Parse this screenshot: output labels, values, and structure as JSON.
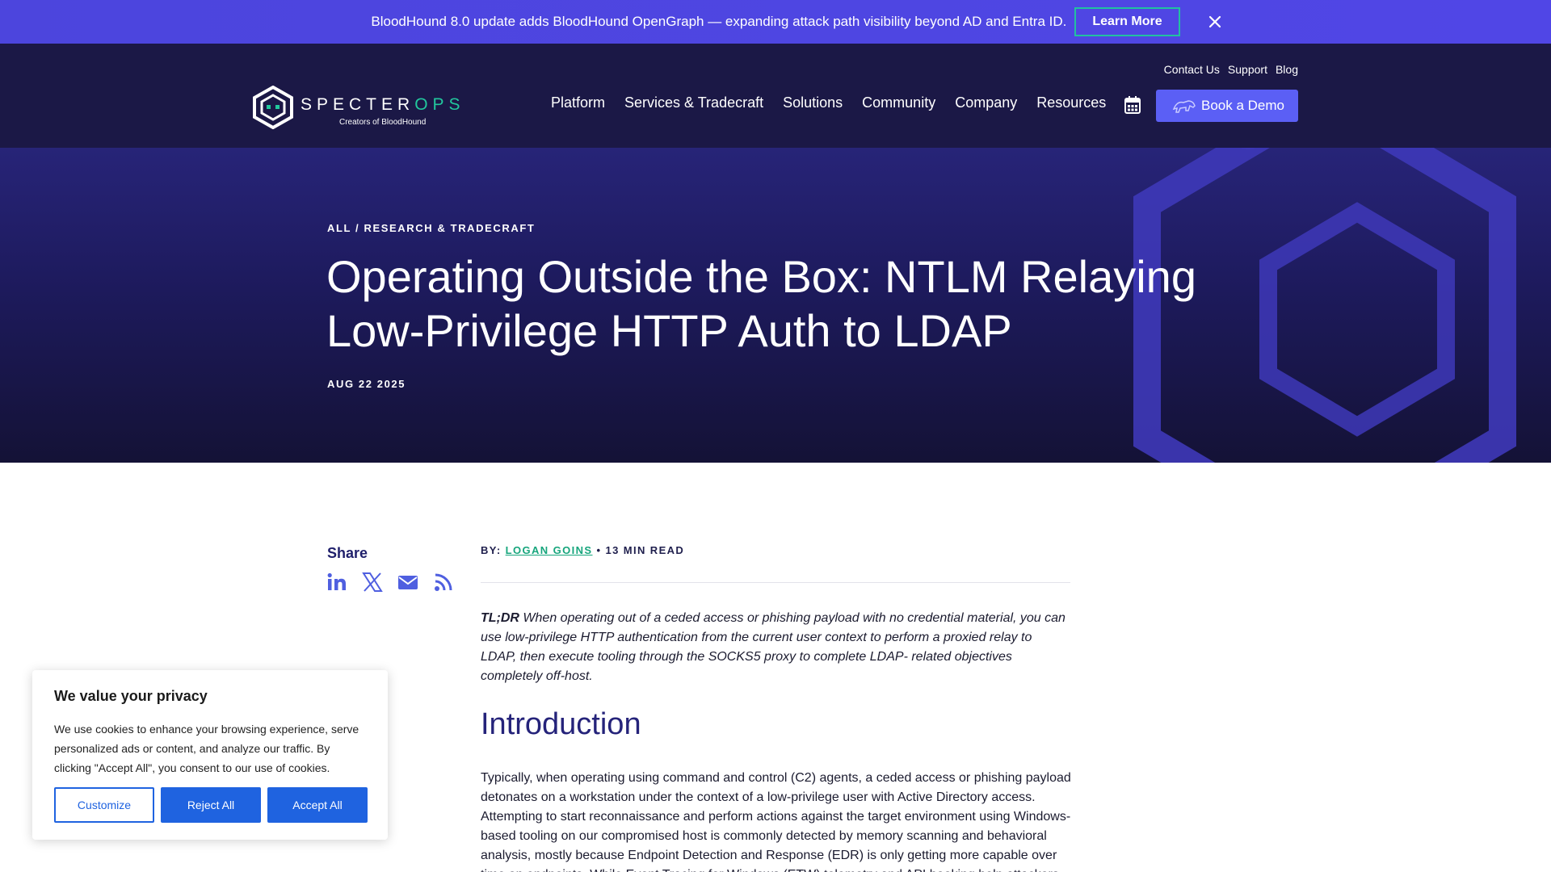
{
  "announcement": {
    "text": "BloodHound 8.0 update adds BloodHound OpenGraph — expanding attack path visibility beyond AD and Entra ID.",
    "cta": "Learn More",
    "close_icon": "close-icon"
  },
  "header": {
    "logo": {
      "word_main": "SPECTER",
      "word_accent": "OPS",
      "tagline": "Creators of BloodHound"
    },
    "util_links": [
      "Contact Us",
      "Support",
      "Blog"
    ],
    "nav": [
      "Platform",
      "Services & Tradecraft",
      "Solutions",
      "Community",
      "Company",
      "Resources"
    ],
    "calendar_icon": "calendar-icon",
    "demo_label": "Book a Demo"
  },
  "hero": {
    "crumb_all": "ALL",
    "crumb_sep": " / ",
    "crumb_category": "RESEARCH & TRADECRAFT",
    "title": "Operating Outside the Box: NTLM Relaying Low-Privilege HTTP Auth to LDAP",
    "date": "AUG 22 2025"
  },
  "share": {
    "label": "Share",
    "icons": [
      "linkedin-icon",
      "x-icon",
      "email-icon",
      "rss-icon"
    ]
  },
  "article": {
    "by_label": "BY: ",
    "author": "LOGAN GOINS",
    "read_time": " • 13 MIN READ",
    "tldr_label": "TL;DR",
    "tldr_text": " When operating out of a ceded access or phishing payload with no credential material, you can use low-privilege HTTP authentication from the current user context to perform a proxied relay to LDAP, then execute tooling through the SOCKS5 proxy to complete LDAP- related objectives completely off-host.",
    "intro_heading": "Introduction",
    "intro_text": "Typically, when operating using command and control (C2) agents, a ceded access or phishing payload detonates on a workstation under the context of a low-privilege user with Active Directory access. Attempting to start reconnaissance and perform actions against the target environment using Windows-based tooling on our compromised host is commonly detected by memory scanning and behavioral analysis, mostly because Endpoint Detection and Response (EDR) is only getting more capable over time on endpoints. While Event Tracing for Windows (ETW) telemetry and API hooking help attackers and defenders alike"
  },
  "cookie": {
    "title": "We value your privacy",
    "text": "We use cookies to enhance your browsing experience, serve personalized ads or content, and analyze our traffic. By clicking \"Accept All\", you consent to our use of cookies.",
    "customize": "Customize",
    "reject": "Reject All",
    "accept": "Accept All"
  },
  "colors": {
    "announce_bg": "#4f46e5",
    "header_bg": "#1b1846",
    "accent_green": "#22c79d",
    "demo_button": "#5b5ff5",
    "cookie_blue": "#1f63e0"
  }
}
